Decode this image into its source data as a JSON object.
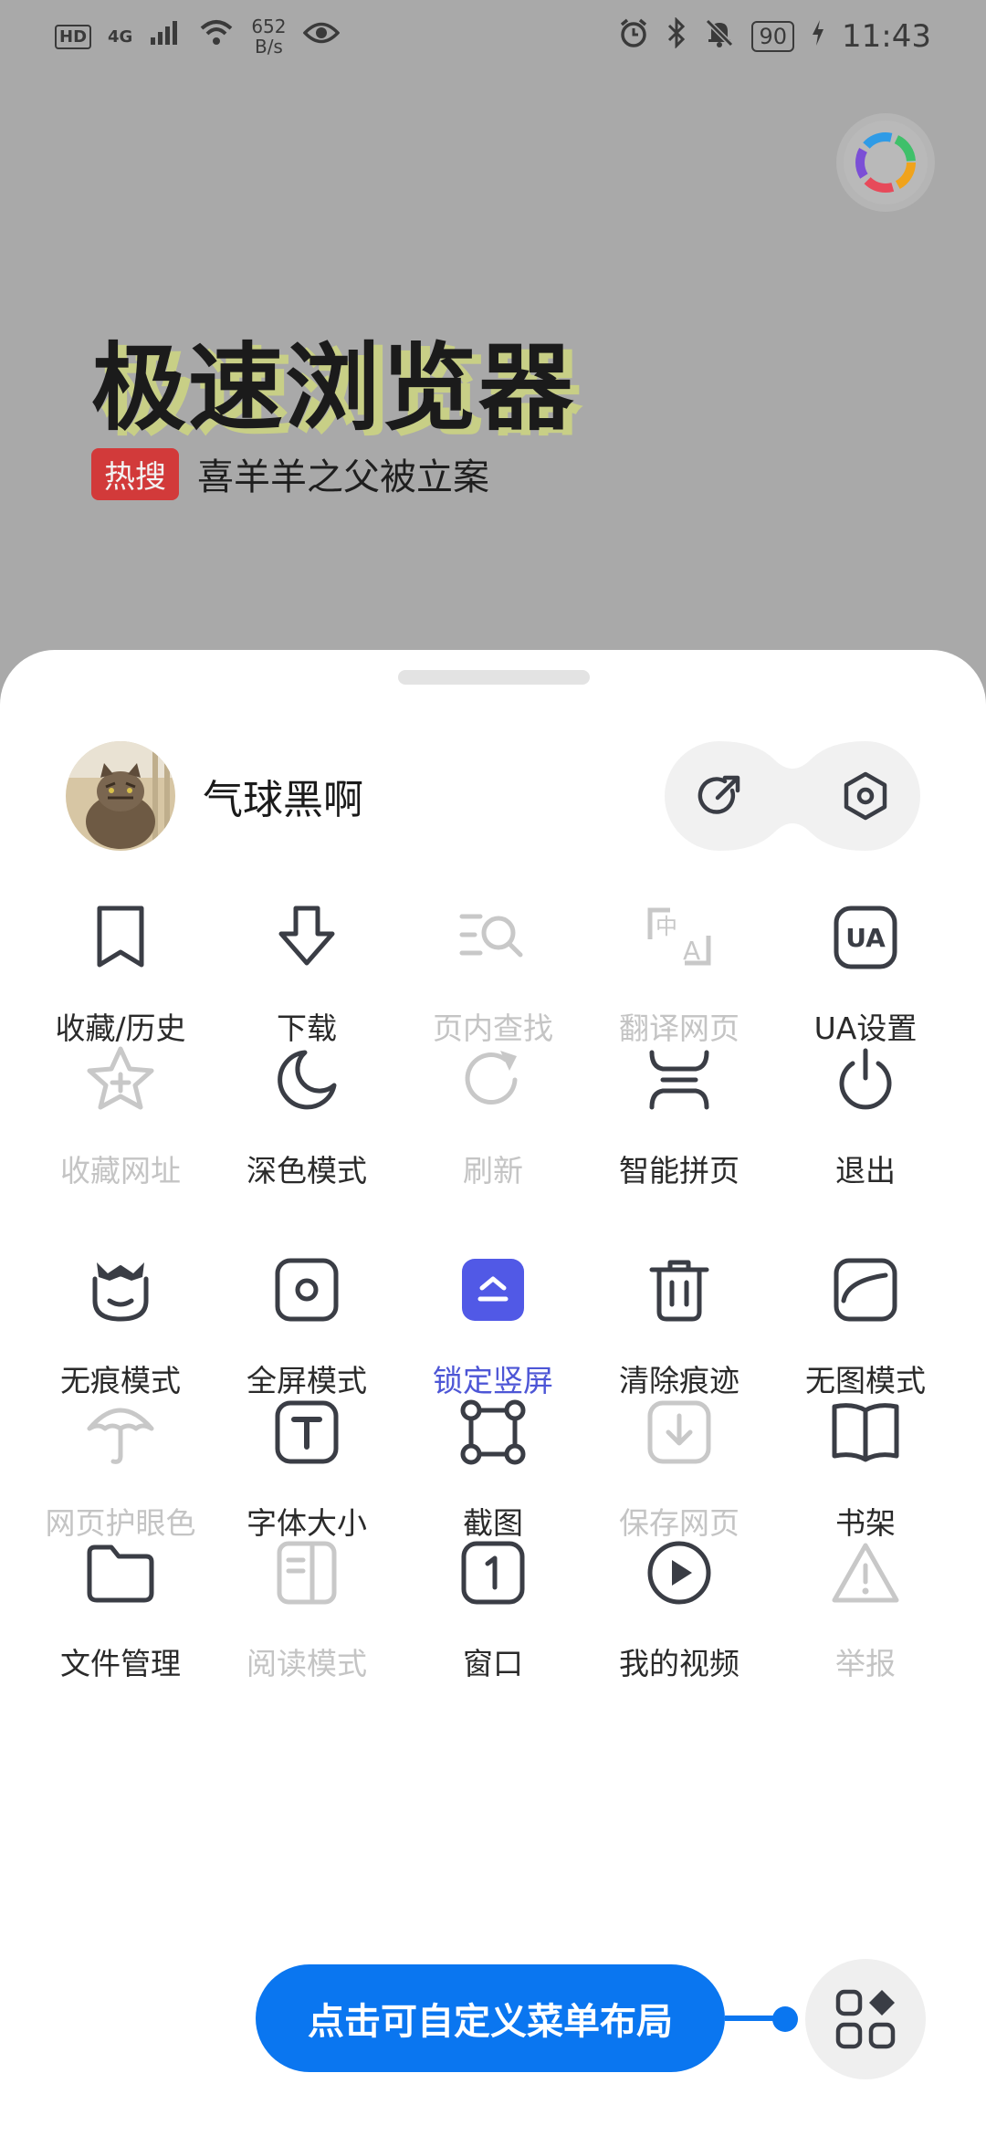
{
  "status_bar": {
    "network_badge": "HD",
    "network_type": "4G",
    "speed_value": "652",
    "speed_unit": "B/s",
    "battery": "90",
    "time": "11:43"
  },
  "page": {
    "title": "极速浏览器",
    "hot_badge": "热搜",
    "hot_text": "喜羊羊之父被立案"
  },
  "profile": {
    "name": "气球黑啊"
  },
  "menu": {
    "items": [
      {
        "label": "收藏/历史",
        "icon": "bookmark-icon",
        "state": "normal"
      },
      {
        "label": "下载",
        "icon": "download-icon",
        "state": "normal"
      },
      {
        "label": "页内查找",
        "icon": "find-in-page-icon",
        "state": "disabled"
      },
      {
        "label": "翻译网页",
        "icon": "translate-icon",
        "state": "disabled"
      },
      {
        "label": "UA设置",
        "icon": "ua-icon",
        "state": "normal"
      },
      {
        "label": "收藏网址",
        "icon": "star-add-icon",
        "state": "disabled"
      },
      {
        "label": "深色模式",
        "icon": "moon-icon",
        "state": "normal"
      },
      {
        "label": "刷新",
        "icon": "refresh-icon",
        "state": "disabled"
      },
      {
        "label": "智能拼页",
        "icon": "smart-page-icon",
        "state": "normal"
      },
      {
        "label": "退出",
        "icon": "power-icon",
        "state": "normal"
      },
      {
        "label": "无痕模式",
        "icon": "incognito-icon",
        "state": "normal"
      },
      {
        "label": "全屏模式",
        "icon": "fullscreen-icon",
        "state": "normal"
      },
      {
        "label": "锁定竖屏",
        "icon": "lock-portrait-icon",
        "state": "active"
      },
      {
        "label": "清除痕迹",
        "icon": "trash-icon",
        "state": "normal"
      },
      {
        "label": "无图模式",
        "icon": "no-image-icon",
        "state": "normal"
      },
      {
        "label": "网页护眼色",
        "icon": "umbrella-icon",
        "state": "disabled"
      },
      {
        "label": "字体大小",
        "icon": "font-size-icon",
        "state": "normal"
      },
      {
        "label": "截图",
        "icon": "screenshot-icon",
        "state": "normal"
      },
      {
        "label": "保存网页",
        "icon": "save-page-icon",
        "state": "disabled"
      },
      {
        "label": "书架",
        "icon": "book-icon",
        "state": "normal"
      },
      {
        "label": "文件管理",
        "icon": "folder-icon",
        "state": "normal"
      },
      {
        "label": "阅读模式",
        "icon": "reader-icon",
        "state": "disabled"
      },
      {
        "label": "窗口",
        "icon": "window-icon",
        "state": "normal"
      },
      {
        "label": "我的视频",
        "icon": "play-icon",
        "state": "normal"
      },
      {
        "label": "举报",
        "icon": "warning-icon",
        "state": "disabled"
      }
    ]
  },
  "tip": {
    "text": "点击可自定义菜单布局"
  },
  "colors": {
    "accent": "#0a76f0",
    "active_item": "#4d56d6",
    "icon_normal": "#3a3d45",
    "icon_disabled": "#c8c8c8"
  }
}
